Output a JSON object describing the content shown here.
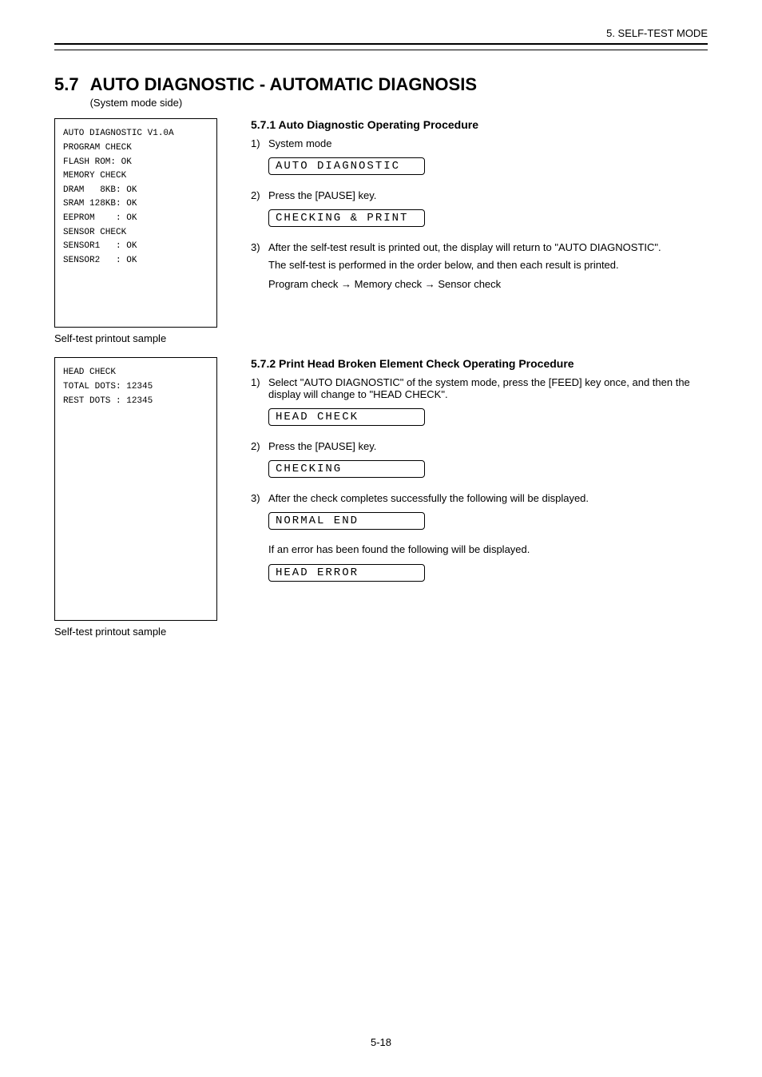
{
  "header": {
    "right_text": "5. SELF-TEST MODE"
  },
  "section": {
    "number": "5.7",
    "title": "AUTO DIAGNOSTIC - AUTOMATIC DIAGNOSIS",
    "subtitle": "(System mode side)"
  },
  "sample1": {
    "label": "Self-test printout sample",
    "lines": [
      "AUTO DIAGNOSTIC V1.0A",
      "",
      "PROGRAM CHECK",
      "FLASH ROM: OK",
      "MEMORY CHECK",
      "DRAM   8KB: OK",
      "SRAM 128KB: OK",
      "EEPROM    : OK",
      "SENSOR CHECK",
      "SENSOR1   : OK",
      "SENSOR2   : OK",
      ""
    ]
  },
  "auto_diag": {
    "heading": "5.7.1  Auto Diagnostic Operating Procedure",
    "step1_num": "1)",
    "step1_label": "System mode",
    "lcd1": "AUTO DIAGNOSTIC",
    "step2_num": "2)",
    "step2_text": "Press the [PAUSE] key.",
    "lcd2": "CHECKING & PRINT",
    "step3_num": "3)",
    "step3_text_a": "After the self-test result is printed out, the display will return to \"",
    "step3_text_b": "\".",
    "step3_lcd_inline": "AUTO DIAGNOSTIC",
    "note": "The self-test is performed in the order below, and then each result is printed.",
    "order": "Program check   →   Memory check   →   Sensor check"
  },
  "head_check": {
    "heading": "5.7.2  Print Head Broken Element Check Operating Procedure",
    "step1_num": "1)",
    "step1_a": "Select \"",
    "step1_b": "\" of the system mode, press the [FEED] key once, and then the display will change to \"",
    "step1_c": "\".",
    "auto_diag_inline": "AUTO DIAGNOSTIC",
    "head_check_inline": "HEAD CHECK",
    "lcd_head": "HEAD CHECK",
    "step2_num": "2)",
    "step2_text": "Press the [PAUSE] key.",
    "lcd_checking": "CHECKING",
    "step3_num": "3)",
    "step3_text": "After the check completes successfully the following will be displayed.",
    "lcd_normal": "NORMAL END",
    "step3_extra": "If an error has been found the following will be displayed.",
    "lcd_error": "HEAD ERROR"
  },
  "sample2": {
    "label": "Self-test printout sample",
    "lines": [
      "HEAD CHECK",
      "",
      "TOTAL DOTS: 12345",
      "REST DOTS : 12345",
      "",
      "",
      "",
      "",
      "",
      "",
      "",
      "",
      "",
      ""
    ]
  },
  "footer": {
    "page": "5-18"
  }
}
